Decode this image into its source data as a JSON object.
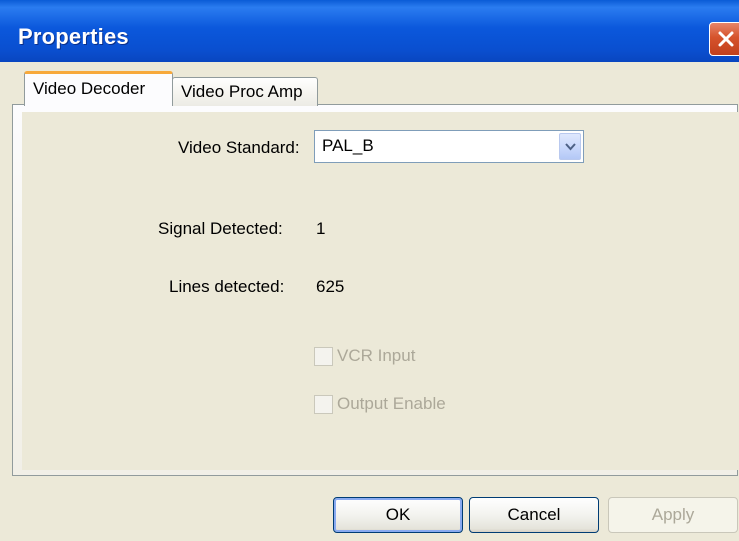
{
  "window": {
    "title": "Properties"
  },
  "tabs": [
    {
      "label": "Video Decoder",
      "active": true
    },
    {
      "label": "Video Proc Amp",
      "active": false
    }
  ],
  "video_decoder": {
    "video_standard_label": "Video Standard:",
    "video_standard_value": "PAL_B",
    "signal_detected_label": "Signal Detected:",
    "signal_detected_value": "1",
    "lines_detected_label": "Lines detected:",
    "lines_detected_value": "625",
    "vcr_input_label": "VCR Input",
    "vcr_input_checked": false,
    "vcr_input_enabled": false,
    "output_enable_label": "Output Enable",
    "output_enable_checked": false,
    "output_enable_enabled": false
  },
  "buttons": {
    "ok": "OK",
    "cancel": "Cancel",
    "apply": "Apply",
    "apply_enabled": false
  },
  "icons": {
    "close": "close-icon",
    "dropdown": "chevron-down-icon"
  },
  "colors": {
    "titlebar": "#0a55d4",
    "close_button": "#d6532c",
    "active_tab_accent": "#f7a93b",
    "dialog_background": "#ece9d8"
  }
}
